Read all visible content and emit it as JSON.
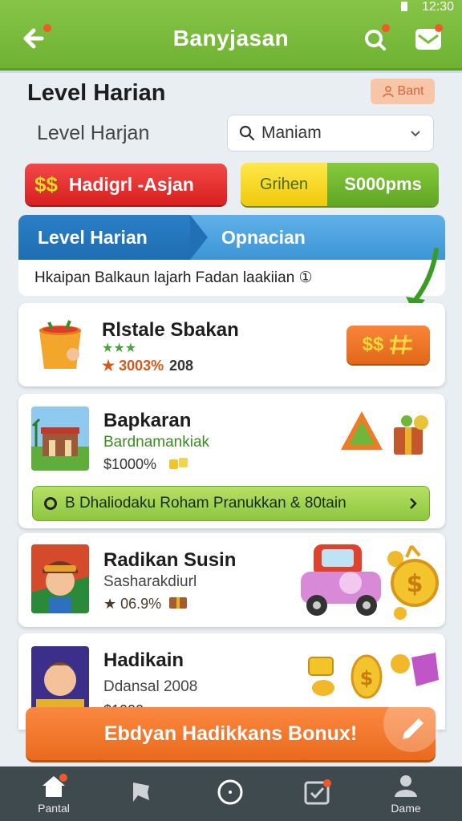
{
  "status": {
    "time": "12:30"
  },
  "header": {
    "title": "Banyjasan"
  },
  "section": {
    "title": "Level Harian",
    "badge_button": "Bant"
  },
  "filter": {
    "label": "Level Harjan",
    "select_value": "Maniam"
  },
  "pills": {
    "red_label": "Hadigrl -Asjan",
    "red_coin": "$$",
    "combo_left": "Grihen",
    "combo_right": "S000pms"
  },
  "tabs": {
    "active": "Level Harian",
    "other": "Opnacian"
  },
  "notice": "Hkaipan Balkaun lajarh Fadan laakiian ①",
  "cards": [
    {
      "title": "Rlstale Sbakan",
      "stars": "★★★",
      "discount": "★ 3003%",
      "count": "208",
      "button": "$$"
    },
    {
      "title": "Bapkaran",
      "subtitle": "Bardnamankiak",
      "price": "$1000%"
    },
    {
      "title": "Radikan Susin",
      "subtitle": "Sasharakdiurl",
      "price": "★ 06.9%"
    },
    {
      "title": "Hadikain",
      "subtitle": "Ddansal 2008",
      "price": "$1000"
    }
  ],
  "promo": {
    "label": "B Dhaliodaku Roham Pranukkan & 80tain"
  },
  "cta": {
    "label": "Ebdyan Hadikkans Bonux!"
  },
  "nav": [
    {
      "label": "Pantal"
    },
    {
      "label": ""
    },
    {
      "label": ""
    },
    {
      "label": ""
    },
    {
      "label": "Dame"
    }
  ],
  "colors": {
    "header": "#7bbd3b",
    "cta": "#f07a2c",
    "red": "#e63232",
    "green": "#79bd36",
    "tab": "#2a7fc6"
  }
}
